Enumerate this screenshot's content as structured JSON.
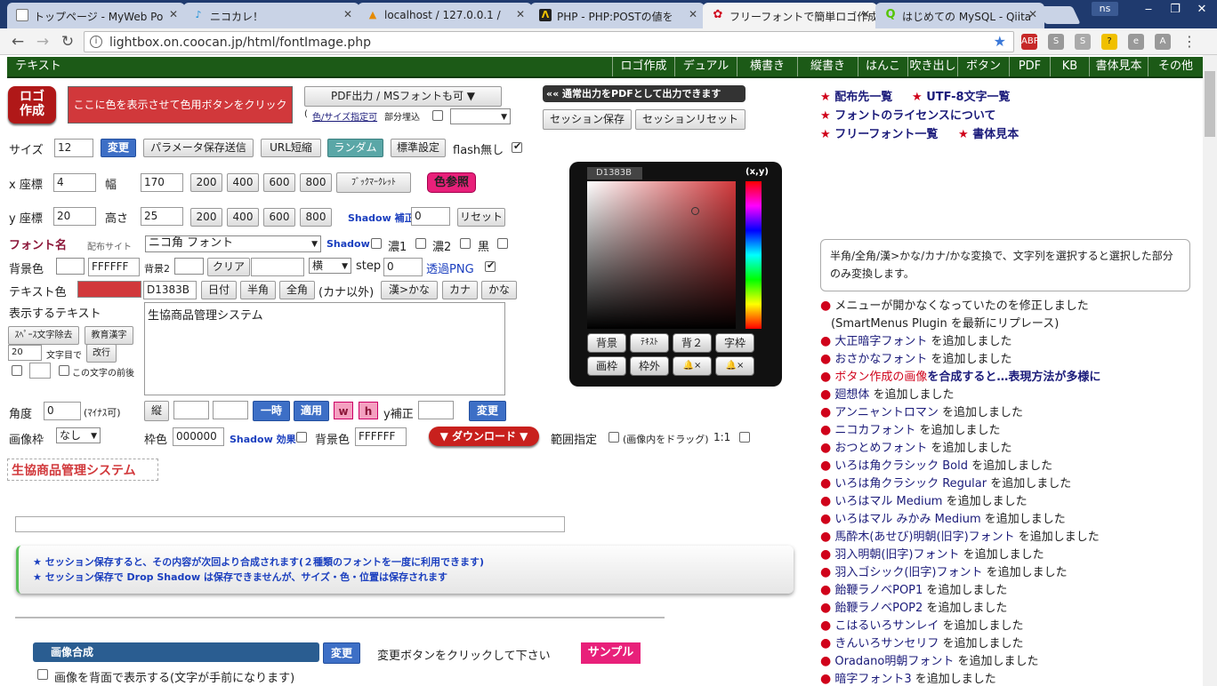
{
  "browser": {
    "tabs": [
      {
        "label": "トップページ - MyWeb Po"
      },
      {
        "label": "ニコカレ！"
      },
      {
        "label": "localhost / 127.0.0.1 /"
      },
      {
        "label": "PHP - PHP:POSTの値を"
      },
      {
        "label": "フリーフォントで簡単ロゴ作成"
      },
      {
        "label": "はじめての MySQL - Qiita"
      }
    ],
    "user": "ns",
    "url": "lightbox.on.coocan.jp/html/fontImage.php"
  },
  "site_nav": {
    "left": "テキスト",
    "items": [
      "ロゴ作成",
      "デュアル",
      "横書き",
      "縦書き",
      "はんこ",
      "吹き出し",
      "ボタン",
      "PDF",
      "KB",
      "書体見本",
      "その他"
    ]
  },
  "logo_btn": {
    "line1": "ロゴ",
    "line2": "作成"
  },
  "color_preview_label": "ここに色を表示させて色用ボタンをクリック",
  "pdf": {
    "button": "PDF出力 / MSフォントも可 ▼",
    "color_size_link": "色/サイズ指定可",
    "partial_embed": "部分埋込",
    "banner": "«« 通常出力をPDFとして出力できます",
    "session_save": "セッション保存",
    "session_reset": "セッションリセット"
  },
  "row_size": {
    "label": "サイズ",
    "value": "12",
    "change": "変更",
    "param_send": "パラメータ保存送信",
    "url_short": "URL短縮",
    "random": "ランダム",
    "default": "標準設定",
    "flash_off": "flash無し"
  },
  "row_x": {
    "label": "x 座標",
    "value": "4",
    "width_label": "幅",
    "width_value": "170",
    "presets": [
      "200",
      "400",
      "600",
      "800"
    ],
    "bookmarklet": "ﾌﾞｯｸﾏｰｸﾚｯﾄ",
    "color_ref": "色参照"
  },
  "row_y": {
    "label": "y 座標",
    "value": "20",
    "height_label": "高さ",
    "height_value": "25",
    "presets": [
      "200",
      "400",
      "600",
      "800"
    ],
    "shadow_adjust": "Shadow 補正",
    "shadow_value": "0",
    "reset": "リセット"
  },
  "row_font": {
    "label": "フォント名",
    "dist_site": "配布サイト",
    "font": "ニコ角 フォント",
    "shadow": "Shadow",
    "dark1": "濃1",
    "dark2": "濃2",
    "black": "黒"
  },
  "row_bg": {
    "label": "背景色",
    "value": "FFFFFF",
    "bg2_label": "背景2",
    "clear": "クリア",
    "direction": "横",
    "step_label": "step",
    "step_value": "0",
    "transparent": "透過PNG"
  },
  "row_text_color": {
    "label": "テキスト色",
    "value": "D1383B",
    "date": "日付",
    "half": "半角",
    "full": "全角",
    "except_kana": "(カナ以外)",
    "kanji_kana": "漢>かな",
    "kana": "カナ",
    "hira": "かな"
  },
  "text_area": {
    "label": "表示するテキスト",
    "value": "生協商品管理システム",
    "remove_space": "ｽﾍﾟｰｽ文字除去",
    "edu_kanji": "教育漢字",
    "chars_value": "20",
    "chars_label": "文字目で",
    "newline": "改行",
    "before_char": "この文字の前後"
  },
  "row_angle": {
    "label": "角度",
    "value": "0",
    "minus_ok": "(ﾏｲﾅｽ可)",
    "vertical": "縦",
    "temp": "一時",
    "apply": "適用",
    "w": "w",
    "h": "h",
    "y_adjust": "y補正",
    "change": "変更"
  },
  "row_frame": {
    "label": "画像枠",
    "frame": "なし",
    "border_label": "枠色",
    "border_value": "000000",
    "shadow_effect": "Shadow 効果",
    "bg_label": "背景色",
    "bg_value": "FFFFFF",
    "download": "▼ ダウンロード ▼",
    "range": "範囲指定",
    "drag_hint": "(画像内をドラッグ)",
    "ratio": "1:1"
  },
  "preview_text": "生協商品管理システム",
  "session_notes": [
    "★ セッション保存すると、その内容が次回より合成されます(２種類のフォントを一度に利用できます)",
    "★ セッション保存で Drop Shadow は保存できませんが、サイズ・色・位置は保存されます"
  ],
  "compose": {
    "header": "画像合成",
    "change": "変更",
    "hint": "変更ボタンをクリックして下さい",
    "sample": "サンプル",
    "behind": "画像を背面で表示する(文字が手前になります)"
  },
  "picker": {
    "hex": "D1383B",
    "xy": "(x,y)",
    "buttons": [
      "背景",
      "ﾃｷｽﾄ",
      "背２",
      "字枠",
      "画枠",
      "枠外",
      "×",
      "×"
    ],
    "hue_color": "#d1383b"
  },
  "right_links": [
    {
      "star": "★",
      "text": "配布先一覧"
    },
    {
      "star": "★",
      "text": "UTF-8文字一覧"
    },
    {
      "star": "★",
      "text": "フォントのライセンスについて"
    },
    {
      "star": "★",
      "text": "フリーフォント一覧"
    },
    {
      "star": "★",
      "text": "書体見本"
    }
  ],
  "info_box": "半角/全角/漢>かな/カナ/かな変換で、文字列を選択すると選択した部分のみ変換します。",
  "news": [
    {
      "name": "メニューが開かなくなっていたのを修正しました",
      "rest": "",
      "style": "plain"
    },
    {
      "name": "(SmartMenus Plugin を最新にリプレース)",
      "rest": "",
      "style": "indent"
    },
    {
      "name": "大正暗字フォント",
      "rest": " を追加しました",
      "style": "link"
    },
    {
      "name": "おさかなフォント",
      "rest": " を追加しました",
      "style": "link"
    },
    {
      "name": "ボタン作成の画像",
      "rest": "を合成すると…表現方法が多様に",
      "style": "red"
    },
    {
      "name": "廻想体",
      "rest": " を追加しました",
      "style": "link"
    },
    {
      "name": "アンニャントロマン",
      "rest": " を追加しました",
      "style": "link"
    },
    {
      "name": "ニコカフォント",
      "rest": " を追加しました",
      "style": "link"
    },
    {
      "name": "おつとめフォント",
      "rest": " を追加しました",
      "style": "link"
    },
    {
      "name": "いろは角クラシック Bold",
      "rest": " を追加しました",
      "style": "link"
    },
    {
      "name": "いろは角クラシック Regular",
      "rest": " を追加しました",
      "style": "link"
    },
    {
      "name": "いろはマル Medium",
      "rest": " を追加しました",
      "style": "link"
    },
    {
      "name": "いろはマル みかみ Medium",
      "rest": " を追加しました",
      "style": "link"
    },
    {
      "name": "馬酔木(あせび)明朝(旧字)フォント",
      "rest": " を追加しました",
      "style": "link"
    },
    {
      "name": "羽入明朝(旧字)フォント",
      "rest": " を追加しました",
      "style": "link"
    },
    {
      "name": "羽入ゴシック(旧字)フォント",
      "rest": " を追加しました",
      "style": "link"
    },
    {
      "name": "飴鞭ラノベPOP1",
      "rest": " を追加しました",
      "style": "link"
    },
    {
      "name": "飴鞭ラノベPOP2",
      "rest": " を追加しました",
      "style": "link"
    },
    {
      "name": "こはるいろサンレイ",
      "rest": " を追加しました",
      "style": "link"
    },
    {
      "name": "きんいろサンセリフ",
      "rest": " を追加しました",
      "style": "link"
    },
    {
      "name": "Oradano明朝フォント",
      "rest": " を追加しました",
      "style": "link"
    },
    {
      "name": "暗字フォント3",
      "rest": " を追加しました",
      "style": "link"
    }
  ]
}
